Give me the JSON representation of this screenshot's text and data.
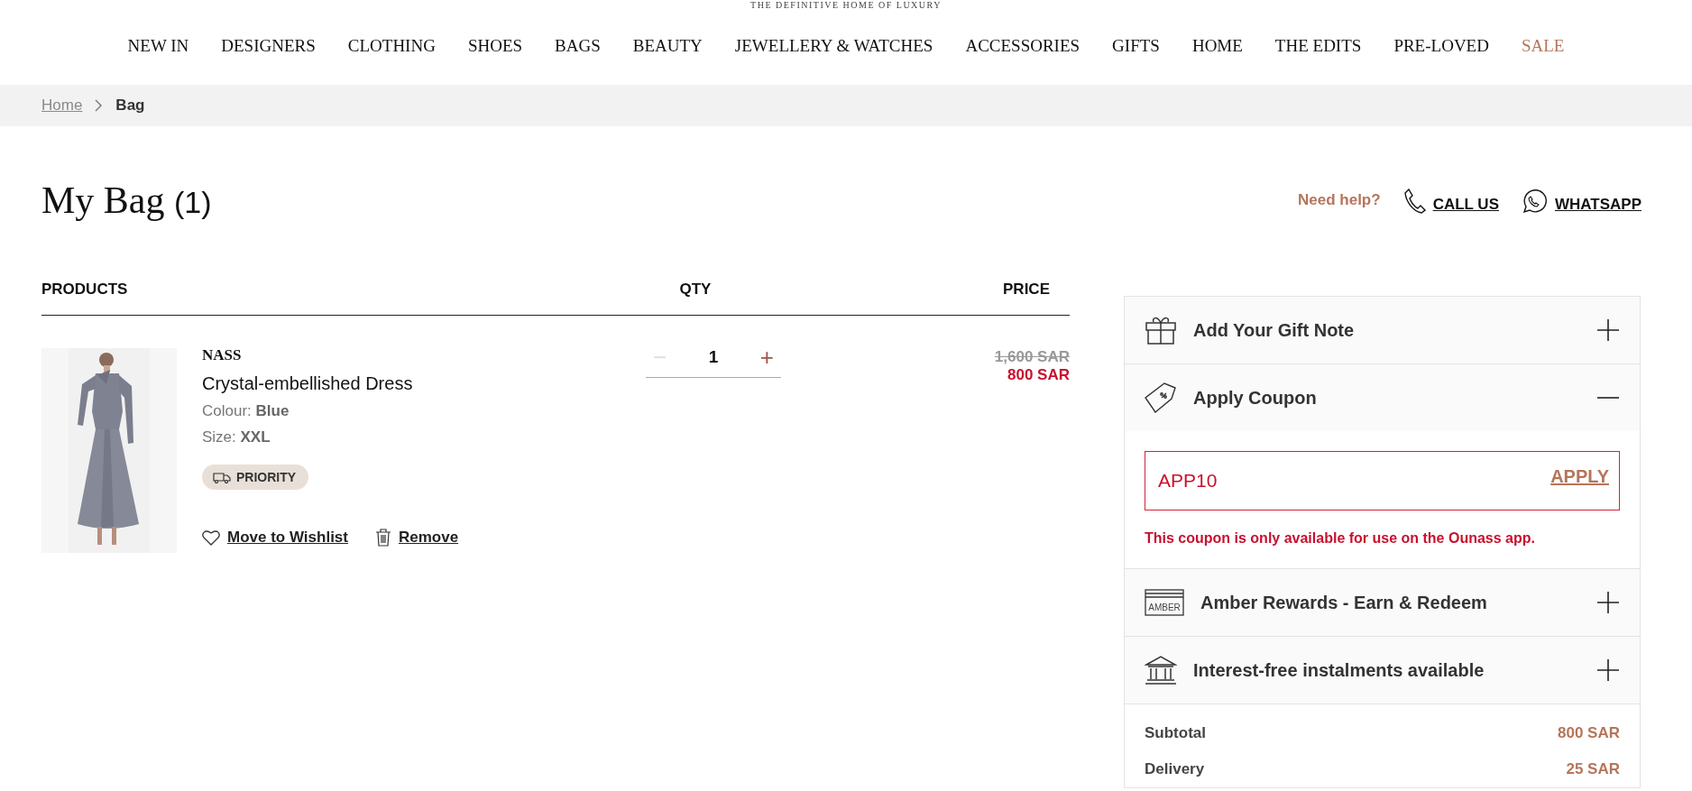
{
  "tagline": "THE DEFINITIVE HOME OF LUXURY",
  "nav": [
    {
      "label": "NEW IN",
      "kind": "normal"
    },
    {
      "label": "DESIGNERS",
      "kind": "normal"
    },
    {
      "label": "CLOTHING",
      "kind": "normal"
    },
    {
      "label": "SHOES",
      "kind": "normal"
    },
    {
      "label": "BAGS",
      "kind": "normal"
    },
    {
      "label": "BEAUTY",
      "kind": "normal"
    },
    {
      "label": "JEWELLERY & WATCHES",
      "kind": "normal"
    },
    {
      "label": "ACCESSORIES",
      "kind": "normal"
    },
    {
      "label": "GIFTS",
      "kind": "normal"
    },
    {
      "label": "HOME",
      "kind": "normal"
    },
    {
      "label": "THE EDITS",
      "kind": "normal"
    },
    {
      "label": "PRE-LOVED",
      "kind": "normal"
    },
    {
      "label": "SALE",
      "kind": "sale"
    }
  ],
  "breadcrumb": [
    {
      "label": "Home",
      "kind": "link"
    },
    {
      "label": "Bag",
      "kind": "current"
    }
  ],
  "title": "My Bag",
  "count": "(1)",
  "help": {
    "label": "Need help?",
    "call": "CALL US",
    "whatsapp": "WHATSAPP"
  },
  "columns": [
    "PRODUCTS",
    "QTY",
    "PRICE"
  ],
  "items": [
    {
      "kind": "picture",
      "brand": "NASS",
      "name": "Crystal-embellished Dress",
      "colour_label": "Colour:",
      "colour": "Blue",
      "size_label": "Size:",
      "size": "XXL",
      "badge": "PRIORITY",
      "qty": "1",
      "decrease_label": "−",
      "increase_label": "+",
      "decrease_disabled": true,
      "old_price": "1,600 SAR",
      "price": "800 SAR",
      "wishlist": "Move to Wishlist",
      "remove": "Remove"
    }
  ],
  "panel": {
    "sections": [
      {
        "kind": "gift",
        "label": "Add Your Gift Note",
        "expanded": false
      },
      {
        "kind": "coupon",
        "label": "Apply Coupon",
        "expanded": true,
        "value": "APP10",
        "button": "APPLY",
        "error": "This coupon is only available for use on the Ounass app."
      },
      {
        "kind": "rewards",
        "label": "Amber Rewards - Earn & Redeem",
        "expanded": false,
        "icon_text": "AMBER"
      },
      {
        "kind": "bank",
        "label": "Interest-free instalments available",
        "expanded": false
      }
    ],
    "totals": [
      {
        "label": "Subtotal",
        "value": "800 SAR"
      },
      {
        "label": "Delivery",
        "value": "25 SAR"
      }
    ]
  }
}
